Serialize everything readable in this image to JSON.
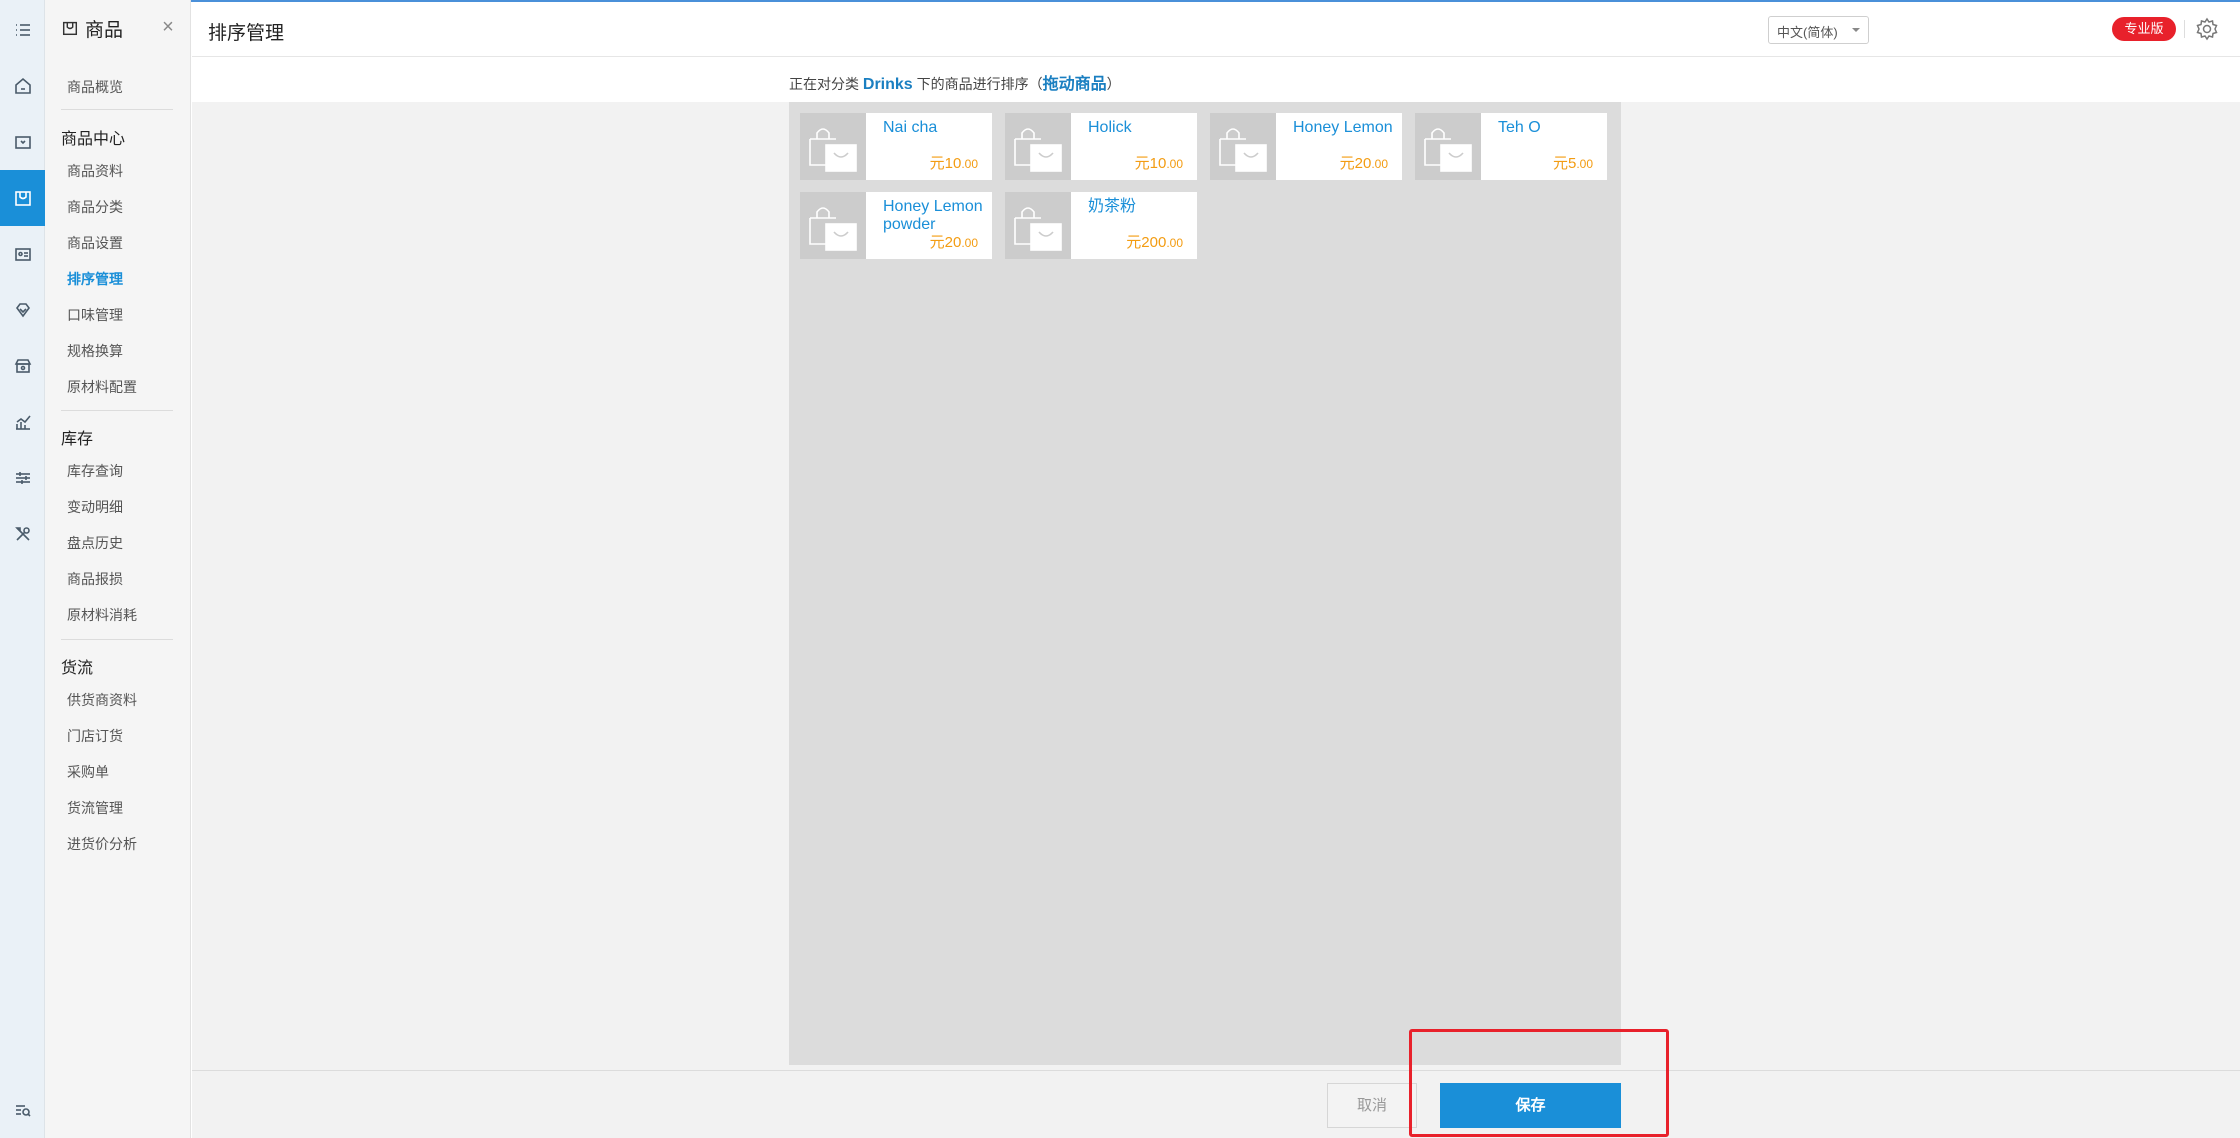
{
  "header": {
    "title": "排序管理",
    "language": "中文(简体)",
    "plan_badge": "专业版"
  },
  "sidebar": {
    "module_title": "商品",
    "overview": "商品概览",
    "groups": [
      {
        "title": "商品中心",
        "items": [
          "商品资料",
          "商品分类",
          "商品设置",
          "排序管理",
          "口味管理",
          "规格换算",
          "原材料配置"
        ]
      },
      {
        "title": "库存",
        "items": [
          "库存查询",
          "变动明细",
          "盘点历史",
          "商品报损",
          "原材料消耗"
        ]
      },
      {
        "title": "货流",
        "items": [
          "供货商资料",
          "门店订货",
          "采购单",
          "货流管理",
          "进货价分析"
        ]
      }
    ],
    "active_item": "排序管理"
  },
  "rail": {
    "icons": [
      "menu-icon",
      "home-icon",
      "register-icon",
      "product-icon",
      "member-card-icon",
      "gem-icon",
      "store-icon",
      "chart-icon",
      "sliders-icon",
      "tools-icon",
      "search-list-icon"
    ],
    "active_index": 3
  },
  "instruction": {
    "prefix": "正在对分类",
    "category": "Drinks",
    "middle": "下的商品进行排序（",
    "emphasis": "拖动商品",
    "suffix": "）"
  },
  "products": [
    {
      "name": "Nai cha",
      "currency": "元",
      "int": "10",
      "dec": ".00"
    },
    {
      "name": "Holick",
      "currency": "元",
      "int": "10",
      "dec": ".00"
    },
    {
      "name": "Honey Lemon",
      "currency": "元",
      "int": "20",
      "dec": ".00"
    },
    {
      "name": "Teh O",
      "currency": "元",
      "int": "5",
      "dec": ".00"
    },
    {
      "name": "Honey Lemon powder",
      "currency": "元",
      "int": "20",
      "dec": ".00"
    },
    {
      "name": "奶茶粉",
      "currency": "元",
      "int": "200",
      "dec": ".00"
    }
  ],
  "footer": {
    "cancel_label": "取消",
    "save_label": "保存"
  },
  "colors": {
    "accent": "#1a8fd8",
    "price": "#f39c12",
    "badge": "#e8212b",
    "highlight": "#e8212b"
  }
}
